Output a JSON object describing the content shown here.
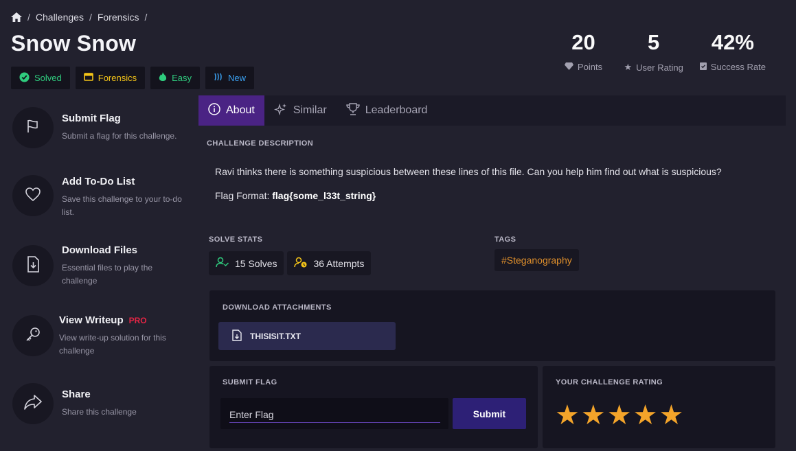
{
  "breadcrumb": {
    "items": [
      "Challenges",
      "Forensics"
    ]
  },
  "challenge": {
    "title": "Snow Snow"
  },
  "badges": {
    "solved": "Solved",
    "category": "Forensics",
    "difficulty": "Easy",
    "status": "New"
  },
  "stats": {
    "points_value": "20",
    "points_label": "Points",
    "rating_value": "5",
    "rating_label": "User Rating",
    "success_value": "42%",
    "success_label": "Success Rate"
  },
  "actions": {
    "submit": {
      "title": "Submit Flag",
      "desc": "Submit a flag for this challenge."
    },
    "todo": {
      "title": "Add To-Do List",
      "desc": "Save this challenge to your to-do list."
    },
    "download": {
      "title": "Download Files",
      "desc": "Essential files to play the challenge"
    },
    "writeup": {
      "title": "View Writeup",
      "pro": "PRO",
      "desc": "View write-up solution for this challenge"
    },
    "share": {
      "title": "Share",
      "desc": "Share this challenge"
    }
  },
  "tabs": {
    "about": "About",
    "similar": "Similar",
    "leaderboard": "Leaderboard"
  },
  "description": {
    "heading": "CHALLENGE DESCRIPTION",
    "text": "Ravi thinks there is something suspicious between these lines of this file. Can you help him find out what is suspicious?",
    "flag_format_label": "Flag Format: ",
    "flag_format_value": "flag{some_l33t_string}"
  },
  "solve_stats": {
    "heading": "SOLVE STATS",
    "solves": "15 Solves",
    "attempts": "36 Attempts"
  },
  "tags": {
    "heading": "TAGS",
    "items": [
      "#Steganography"
    ]
  },
  "attachments": {
    "heading": "DOWNLOAD ATTACHMENTS",
    "file": "THISISIT.TXT"
  },
  "submit_flag": {
    "heading": "SUBMIT FLAG",
    "placeholder": "Enter Flag",
    "button": "Submit"
  },
  "rating": {
    "heading": "YOUR CHALLENGE RATING",
    "stars": 5
  },
  "colors": {
    "accent": "#4a2384",
    "star": "#f3a42a",
    "success": "#2fcc7e",
    "warning": "#f5c518",
    "tag": "#e0902c"
  }
}
